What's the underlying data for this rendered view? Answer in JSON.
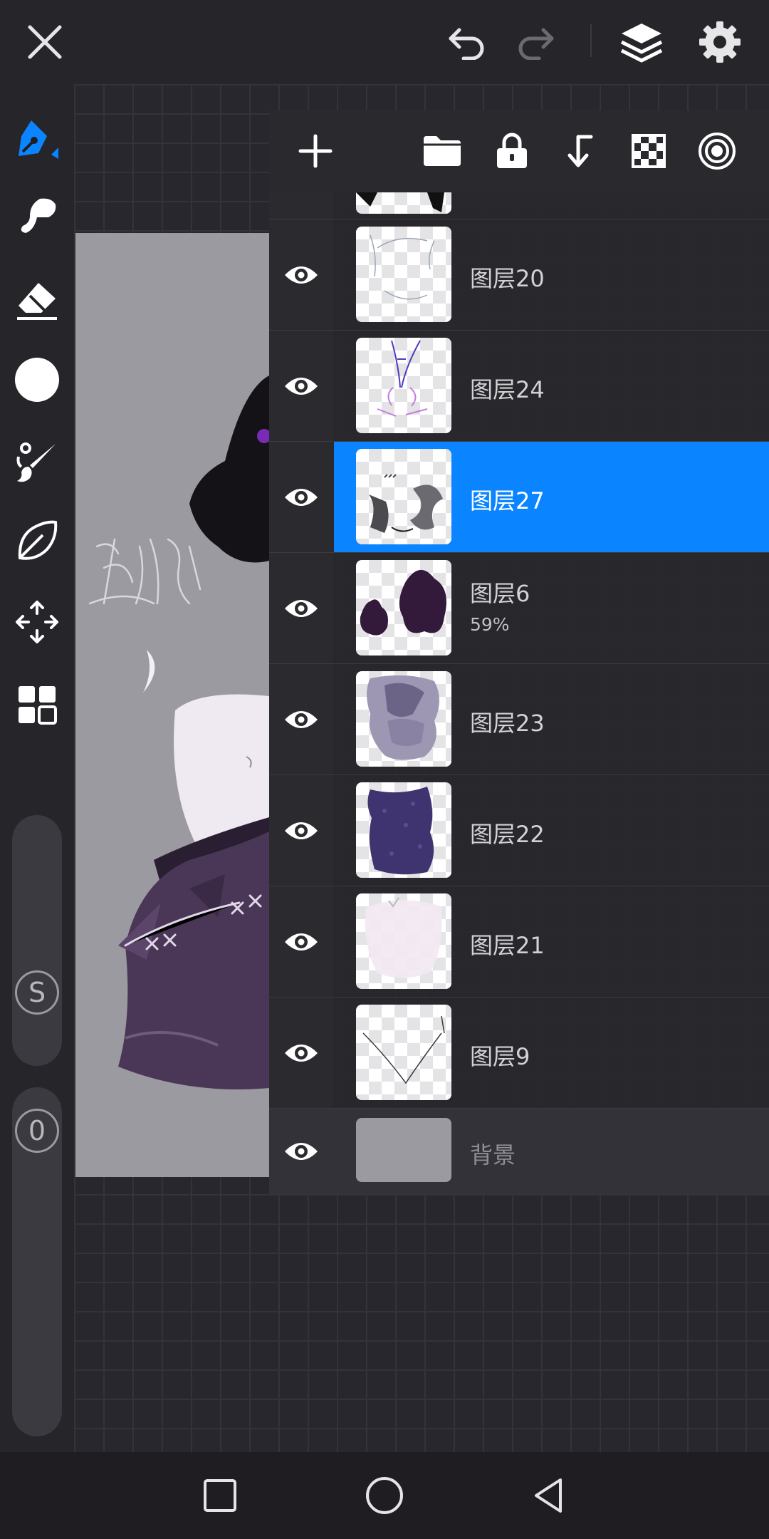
{
  "layers_panel": {
    "layers": [
      {
        "name": "图层20",
        "opacity": "",
        "selected": false
      },
      {
        "name": "图层24",
        "opacity": "",
        "selected": false
      },
      {
        "name": "图层27",
        "opacity": "",
        "selected": true
      },
      {
        "name": "图层6",
        "opacity": "59%",
        "selected": false
      },
      {
        "name": "图层23",
        "opacity": "",
        "selected": false
      },
      {
        "name": "图层22",
        "opacity": "",
        "selected": false
      },
      {
        "name": "图层21",
        "opacity": "",
        "selected": false
      },
      {
        "name": "图层9",
        "opacity": "",
        "selected": false
      }
    ],
    "background_layer": {
      "name": "背景"
    }
  },
  "sliders": {
    "size_badge": "S",
    "opacity_badge": "0"
  },
  "colors": {
    "accent": "#0a84ff",
    "current_color": "#ffffff"
  }
}
